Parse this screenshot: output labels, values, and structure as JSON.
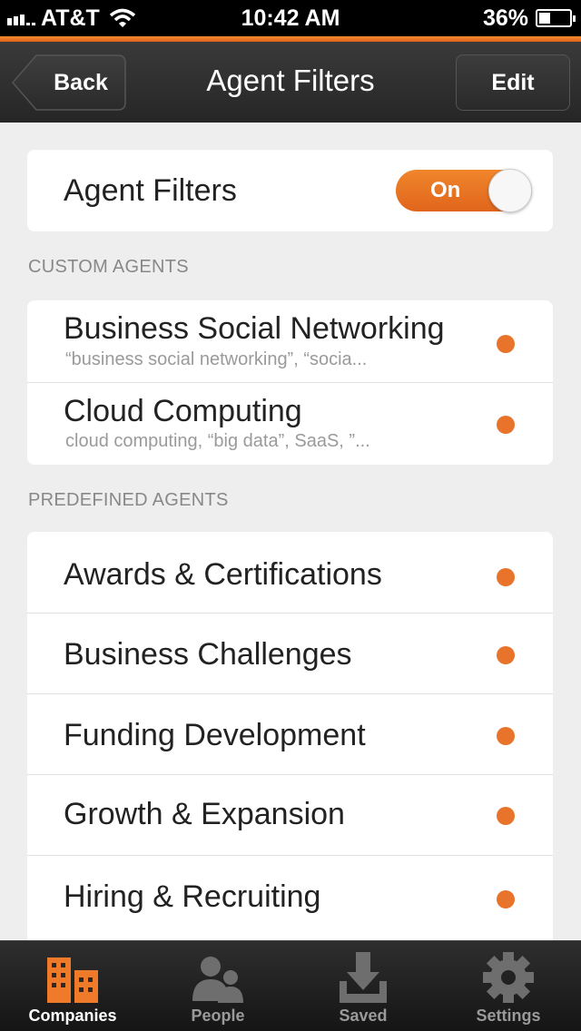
{
  "status_bar": {
    "carrier": "AT&T",
    "time": "10:42 AM",
    "battery": "36%",
    "battery_level": 0.36
  },
  "nav": {
    "back_label": "Back",
    "title": "Agent Filters",
    "edit_label": "Edit"
  },
  "filter_toggle": {
    "label": "Agent Filters",
    "state": "On"
  },
  "custom_agents": {
    "header": "CUSTOM AGENTS",
    "items": [
      {
        "title": "Business Social Networking",
        "subtitle": "“business social networking”, “socia..."
      },
      {
        "title": "Cloud Computing",
        "subtitle": "cloud computing, “big data”,  SaaS, ”..."
      }
    ]
  },
  "predefined_agents": {
    "header": "PREDEFINED AGENTS",
    "items": [
      {
        "title": "Awards & Certifications"
      },
      {
        "title": "Business Challenges"
      },
      {
        "title": "Funding Development"
      },
      {
        "title": "Growth & Expansion"
      },
      {
        "title": "Hiring & Recruiting"
      }
    ]
  },
  "tab_bar": {
    "tabs": [
      {
        "label": "Companies",
        "icon": "buildings-icon",
        "active": true
      },
      {
        "label": "People",
        "icon": "people-icon",
        "active": false
      },
      {
        "label": "Saved",
        "icon": "download-tray-icon",
        "active": false
      },
      {
        "label": "Settings",
        "icon": "gear-icon",
        "active": false
      }
    ]
  },
  "colors": {
    "accent": "#e8732a",
    "nav_background": "#2b2b2b",
    "page_background": "#eeeeee"
  }
}
